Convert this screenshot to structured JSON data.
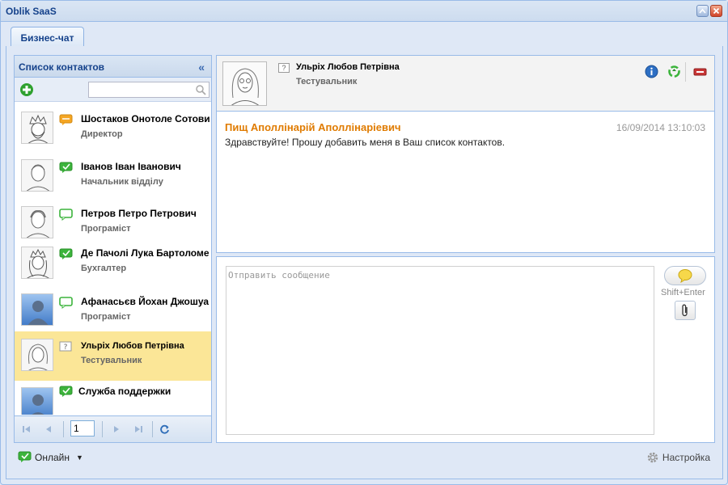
{
  "window": {
    "title": "Oblik SaaS"
  },
  "tabs": [
    {
      "label": "Бизнес-чат",
      "active": true
    }
  ],
  "contacts_panel": {
    "title": "Список контактов",
    "search": {
      "value": "",
      "placeholder": ""
    },
    "contacts": [
      {
        "name": "Шостаков Онотоле Сотович",
        "role": "Директор",
        "status": "away",
        "avatar": "sketch-king"
      },
      {
        "name": "Іванов Іван Іванович",
        "role": "Начальник відділу",
        "status": "online",
        "avatar": "sketch-man"
      },
      {
        "name": "Петров Петро Петрович",
        "role": "Програміст",
        "status": "offline",
        "avatar": "sketch-man"
      },
      {
        "name": "Де Пачолі Лука Бартоломе",
        "role": "Бухгалтер",
        "status": "online",
        "avatar": "sketch-king"
      },
      {
        "name": "Афанасьєв Йохан Джошуа",
        "role": "Програміст",
        "status": "offline",
        "avatar": "silhouette"
      },
      {
        "name": "Ульріх Любов Петрівна",
        "role": "Тестувальник",
        "status": "unknown",
        "avatar": "sketch-woman",
        "selected": true
      },
      {
        "name": "Служба поддержки",
        "role": "",
        "status": "online",
        "avatar": "silhouette"
      }
    ],
    "pager": {
      "page": "1"
    }
  },
  "chat": {
    "contact_name": "Ульріх Любов Петрівна",
    "contact_role": "Тестувальник",
    "status_glyph": "?",
    "messages": [
      {
        "author": "Пищ Аполлінарій Аполлінаріевич",
        "time": "16/09/2014 13:10:03",
        "text": "Здравствуйте! Прошу добавить меня в Ваш список контактов."
      }
    ],
    "compose": {
      "placeholder": "Отправить сообщение",
      "send_hint": "Shift+Enter"
    }
  },
  "statusbar": {
    "status_label": "Онлайн",
    "settings_label": "Настройка"
  },
  "colors": {
    "accent": "#15428b",
    "author": "#e07b00",
    "selected_row": "#fbe697",
    "online_green": "#3cb43c"
  }
}
